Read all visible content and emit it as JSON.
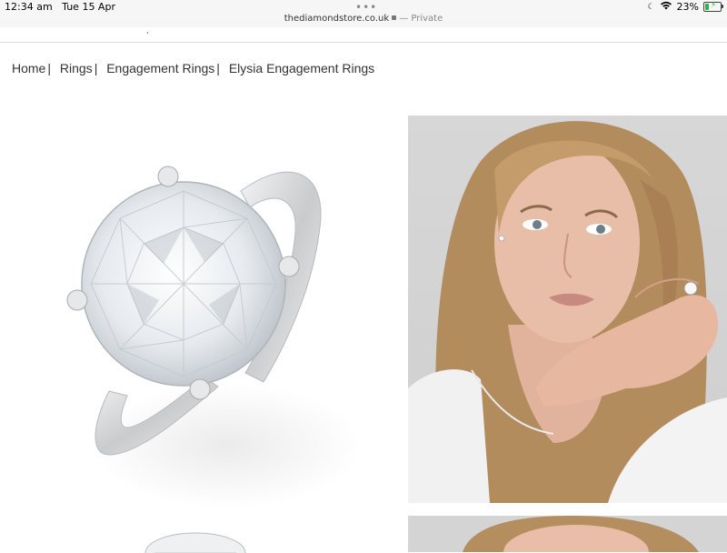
{
  "status_bar": {
    "time": "12:34 am",
    "date": "Tue 15 Apr",
    "battery": "23%",
    "battery_level": 0.23
  },
  "address_bar": {
    "domain": "thediamondstore.co.uk",
    "private_label": "— Private"
  },
  "breadcrumb": [
    {
      "label": "Home"
    },
    {
      "label": "Rings"
    },
    {
      "label": "Engagement Rings"
    },
    {
      "label": "Elysia Engagement Rings"
    }
  ],
  "colors": {
    "metal": "#c8cacc",
    "diamond": "#e9edf0",
    "photo_bg": "#d3d3d3",
    "hair": "#b89567",
    "skin": "#e3b8a2"
  }
}
